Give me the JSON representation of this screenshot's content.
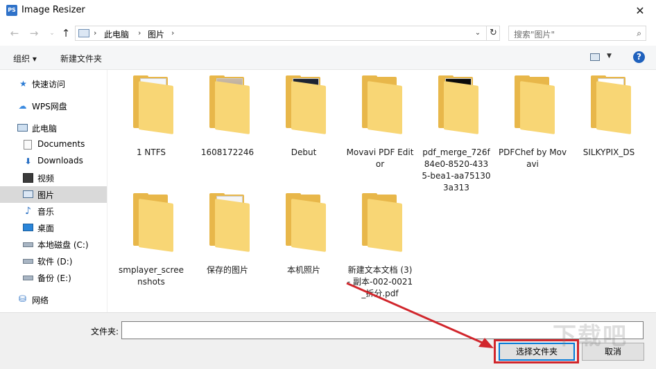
{
  "window": {
    "title": "Image Resizer",
    "icon_text": "PS"
  },
  "nav": {
    "path": [
      "此电脑",
      "图片"
    ],
    "search_placeholder": "搜索\"图片\""
  },
  "toolbar": {
    "organize": "组织 ▾",
    "new_folder": "新建文件夹"
  },
  "sidebar": {
    "items": [
      {
        "label": "快速访问",
        "icon": "star-icon"
      },
      {
        "label": "WPS网盘",
        "icon": "cloud-icon"
      },
      {
        "label": "此电脑",
        "icon": "computer-icon"
      },
      {
        "label": "Documents",
        "icon": "document-icon"
      },
      {
        "label": "Downloads",
        "icon": "download-icon"
      },
      {
        "label": "视频",
        "icon": "video-icon"
      },
      {
        "label": "图片",
        "icon": "picture-icon",
        "selected": true
      },
      {
        "label": "音乐",
        "icon": "music-icon"
      },
      {
        "label": "桌面",
        "icon": "desktop-icon"
      },
      {
        "label": "本地磁盘 (C:)",
        "icon": "drive-icon"
      },
      {
        "label": "软件 (D:)",
        "icon": "drive-icon"
      },
      {
        "label": "备份 (E:)",
        "icon": "drive-icon"
      },
      {
        "label": "网络",
        "icon": "network-icon"
      }
    ]
  },
  "folders": [
    {
      "name": "1 NTFS",
      "preview": "doc"
    },
    {
      "name": "1608172246",
      "preview": "photo"
    },
    {
      "name": "Debut",
      "preview": "dark-app"
    },
    {
      "name": "Movavi PDF Editor",
      "preview": "empty"
    },
    {
      "name": "pdf_merge_726f84e0-8520-4335-bea1-aa751303a313",
      "preview": "black"
    },
    {
      "name": "PDFChef by Movavi",
      "preview": "empty"
    },
    {
      "name": "SILKYPIX_DS",
      "preview": "white"
    },
    {
      "name": "smplayer_screenshots",
      "preview": "empty"
    },
    {
      "name": "保存的图片",
      "preview": "strawberry"
    },
    {
      "name": "本机照片",
      "preview": "empty"
    },
    {
      "name": "新建文本文档 (3) - 副本-002-0021_拆分.pdf",
      "preview": "empty"
    }
  ],
  "bottom": {
    "folder_label": "文件夹:",
    "folder_value": "",
    "select_button": "选择文件夹",
    "cancel_button": "取消"
  },
  "colors": {
    "accent": "#0078d7",
    "highlight": "#d1262c",
    "folder": "#f8d675",
    "selected_bg": "#d9d9d9"
  }
}
